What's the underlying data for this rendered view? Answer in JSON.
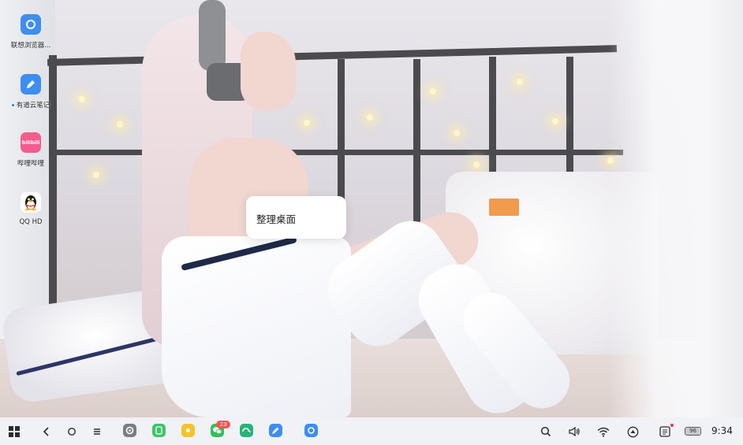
{
  "desktop": {
    "icons": [
      {
        "label": "联想浏览器...",
        "icon": "browser-ring-icon",
        "color": "#3d8ef0"
      },
      {
        "label": "有道云笔记",
        "icon": "note-pen-icon",
        "color": "#3d8ef0",
        "has_dot": true
      },
      {
        "label": "哔哩哔哩",
        "icon": "bilibili-icon",
        "color": "#f25d8e",
        "logo_text": "bilibili"
      },
      {
        "label": "QQ HD",
        "icon": "qq-penguin-icon",
        "color": "#ffffff"
      }
    ]
  },
  "context_menu": {
    "items": [
      {
        "label": "整理桌面"
      }
    ]
  },
  "taskbar": {
    "left_buttons": [
      {
        "name": "start-grid-icon"
      },
      {
        "name": "back-icon",
        "glyph": "‹"
      },
      {
        "name": "home-circle-icon",
        "glyph": "○"
      },
      {
        "name": "menu-lines-icon",
        "glyph": "≡"
      }
    ],
    "apps": [
      {
        "name": "settings-app-icon",
        "color": "#7b7d82"
      },
      {
        "name": "green-app-icon",
        "color": "#3fc46a"
      },
      {
        "name": "yellow-app-icon",
        "color": "#f5c12e"
      },
      {
        "name": "wechat-app-icon",
        "color": "#2ec25b",
        "badge": "23"
      },
      {
        "name": "cloud-app-icon",
        "color": "#27b37a"
      },
      {
        "name": "note-app-icon",
        "color": "#3d8ef0"
      },
      {
        "name": "browser-app-icon",
        "color": "#3d8ef0",
        "active": true
      }
    ],
    "tray": [
      {
        "name": "search-icon"
      },
      {
        "name": "volume-icon"
      },
      {
        "name": "wifi-icon"
      },
      {
        "name": "eject-icon"
      },
      {
        "name": "notification-list-icon",
        "has_dot": true
      }
    ],
    "battery": "96",
    "time": "9:34"
  }
}
